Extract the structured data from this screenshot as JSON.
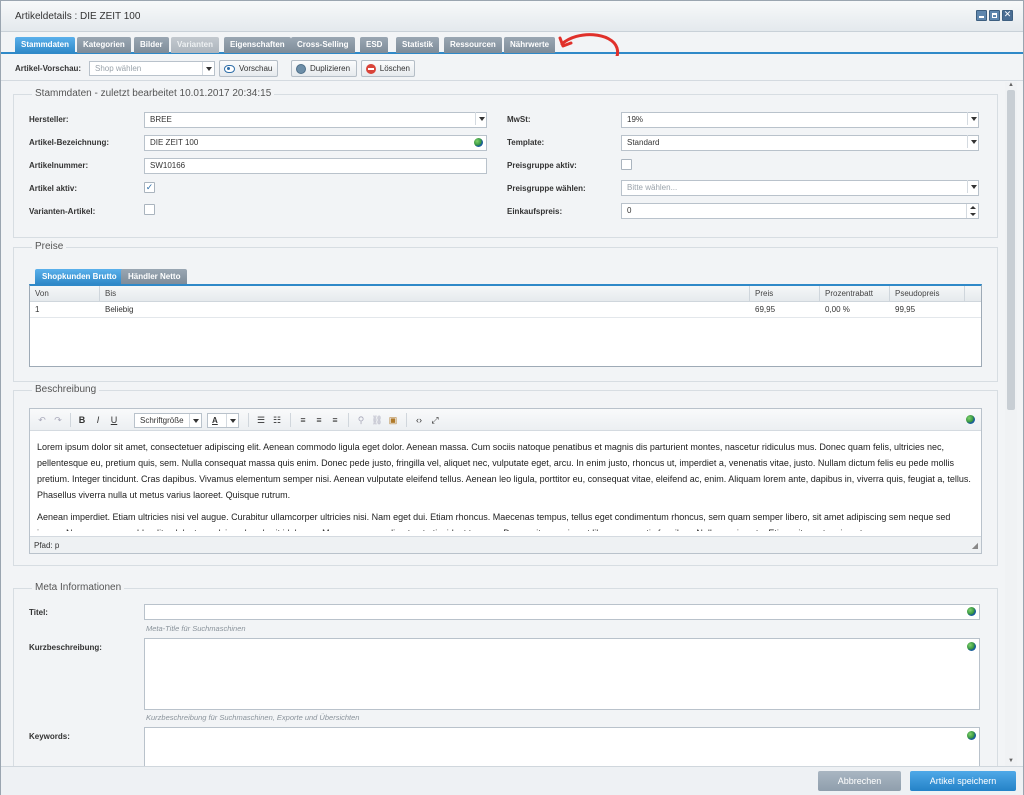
{
  "window": {
    "title": "Artikeldetails : DIE ZEIT 100"
  },
  "tabs": [
    {
      "label": "Stammdaten",
      "state": "active"
    },
    {
      "label": "Kategorien",
      "state": "normal"
    },
    {
      "label": "Bilder",
      "state": "normal"
    },
    {
      "label": "Varianten",
      "state": "disabled"
    },
    {
      "label": "Eigenschaften",
      "state": "normal"
    },
    {
      "label": "Cross-Selling",
      "state": "normal"
    },
    {
      "label": "ESD",
      "state": "normal"
    },
    {
      "label": "Statistik",
      "state": "normal"
    },
    {
      "label": "Ressourcen",
      "state": "normal"
    },
    {
      "label": "Nährwerte",
      "state": "normal"
    }
  ],
  "toolbar": {
    "preview_label": "Artikel-Vorschau:",
    "shop_placeholder": "Shop wählen",
    "preview_button": "Vorschau",
    "duplicate_button": "Duplizieren",
    "delete_button": "Löschen"
  },
  "stammdaten": {
    "legend": "Stammdaten - zuletzt bearbeitet 10.01.2017 20:34:15",
    "hersteller_label": "Hersteller:",
    "hersteller_value": "BREE",
    "bezeichnung_label": "Artikel-Bezeichnung:",
    "bezeichnung_value": "DIE ZEIT 100",
    "nummer_label": "Artikelnummer:",
    "nummer_value": "SW10166",
    "aktiv_label": "Artikel aktiv:",
    "aktiv_checked": "✓",
    "varianten_label": "Varianten-Artikel:",
    "mwst_label": "MwSt:",
    "mwst_value": "19%",
    "template_label": "Template:",
    "template_value": "Standard",
    "preisgruppe_aktiv_label": "Preisgruppe aktiv:",
    "preisgruppe_label": "Preisgruppe wählen:",
    "preisgruppe_placeholder": "Bitte wählen...",
    "einkaufspreis_label": "Einkaufspreis:",
    "einkaufspreis_value": "0"
  },
  "preise": {
    "legend": "Preise",
    "tabs": [
      {
        "label": "Shopkunden Brutto",
        "state": "active"
      },
      {
        "label": "Händler Netto",
        "state": "normal"
      }
    ],
    "columns": [
      "Von",
      "Bis",
      "Preis",
      "Prozentrabatt",
      "Pseudopreis"
    ],
    "rows": [
      [
        "1",
        "Beliebig",
        "69,95",
        "0,00 %",
        "99,95"
      ]
    ]
  },
  "beschreibung": {
    "legend": "Beschreibung",
    "font_size_label": "Schriftgröße",
    "paragraphs": [
      "Lorem ipsum dolor sit amet, consectetuer adipiscing elit. Aenean commodo ligula eget dolor. Aenean massa. Cum sociis natoque penatibus et magnis dis parturient montes, nascetur ridiculus mus. Donec quam felis, ultricies nec, pellentesque eu, pretium quis, sem. Nulla consequat massa quis enim. Donec pede justo, fringilla vel, aliquet nec, vulputate eget, arcu. In enim justo, rhoncus ut, imperdiet a, venenatis vitae, justo. Nullam dictum felis eu pede mollis pretium. Integer tincidunt. Cras dapibus. Vivamus elementum semper nisi. Aenean vulputate eleifend tellus. Aenean leo ligula, porttitor eu, consequat vitae, eleifend ac, enim. Aliquam lorem ante, dapibus in, viverra quis, feugiat a, tellus. Phasellus viverra nulla ut metus varius laoreet. Quisque rutrum.",
      "Aenean imperdiet. Etiam ultricies nisi vel augue. Curabitur ullamcorper ultricies nisi. Nam eget dui. Etiam rhoncus. Maecenas tempus, tellus eget condimentum rhoncus, sem quam semper libero, sit amet adipiscing sem neque sed ipsum. Nam quam nunc, blandit vel, luctus pulvinar, hendrerit id, lorem. Maecenas nec odio et ante tincidunt tempus. Donec vitae sapien ut libero venenatis faucibus. Nullam quis ante. Etiam sit amet orci eget"
    ],
    "path_label": "Pfad: p"
  },
  "meta": {
    "legend": "Meta Informationen",
    "titel_label": "Titel:",
    "titel_hint": "Meta-Title für Suchmaschinen",
    "kurz_label": "Kurzbeschreibung:",
    "kurz_hint": "Kurzbeschreibung für Suchmaschinen, Exporte und Übersichten",
    "keywords_label": "Keywords:"
  },
  "footer": {
    "cancel_button": "Abbrechen",
    "save_button": "Artikel speichern"
  },
  "colors": {
    "accent": "#2f89c8",
    "annotation_arrow": "#e0302a"
  }
}
